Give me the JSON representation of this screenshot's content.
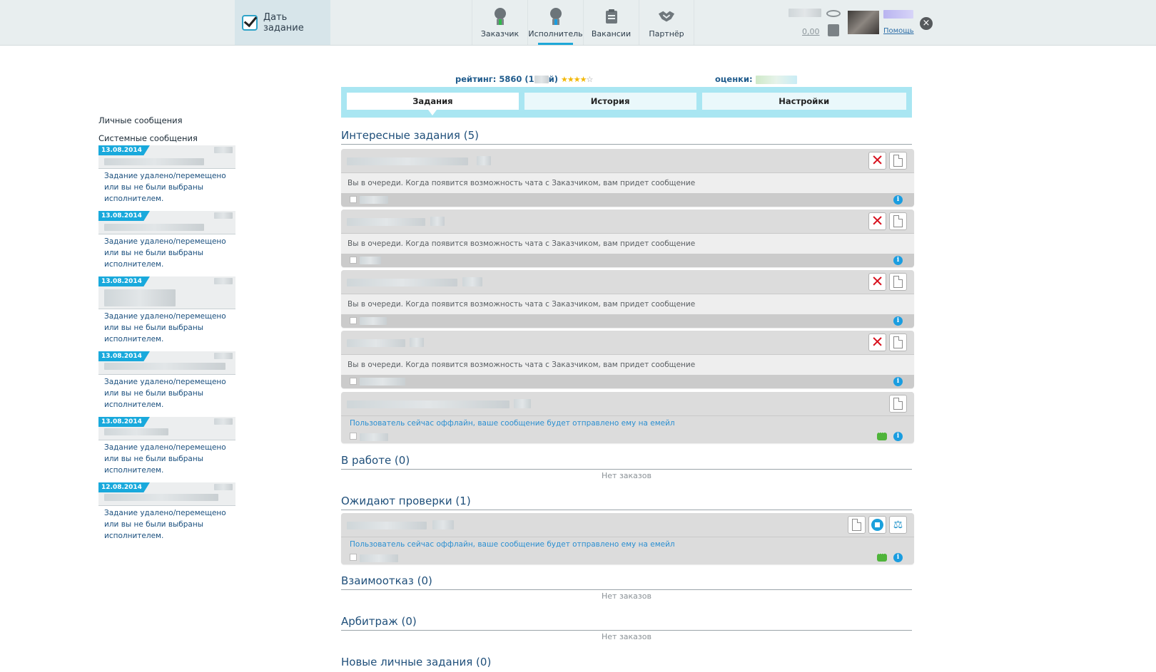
{
  "header": {
    "give_task_label": "Дать задание",
    "nav": [
      {
        "label": "Заказчик",
        "icon": "person-customer-icon"
      },
      {
        "label": "Исполнитель",
        "icon": "person-executor-icon"
      },
      {
        "label": "Вакансии",
        "icon": "clipboard-icon"
      },
      {
        "label": "Партнёр",
        "icon": "handshake-icon"
      }
    ],
    "balance": "0,00",
    "help_label": "Помощь",
    "close_icon": "close-icon"
  },
  "sidebar": {
    "personal_messages": "Личные сообщения",
    "system_messages": "Системные сообщения",
    "messages": [
      {
        "date": "13.08.2014",
        "text": "Задание удалено/перемещено или вы не были выбраны исполнителем."
      },
      {
        "date": "13.08.2014",
        "text": "Задание удалено/перемещено или вы не были выбраны исполнителем."
      },
      {
        "date": "13.08.2014",
        "text": "Задание удалено/перемещено или вы не были выбраны исполнителем."
      },
      {
        "date": "13.08.2014",
        "text": "Задание удалено/перемещено или вы не были выбраны исполнителем."
      },
      {
        "date": "13.08.2014",
        "text": "Задание удалено/перемещено или вы не были выбраны исполнителем."
      },
      {
        "date": "12.08.2014",
        "text": "Задание удалено/перемещено или вы не были выбраны исполнителем."
      }
    ]
  },
  "profile": {
    "rating_label": "рейтинг:",
    "rating_value": "5860",
    "rating_suffix": "(1",
    "rating_suffix_end": "й)",
    "stars_filled": 4,
    "stars_total": 5,
    "scores_label": "оценки:"
  },
  "tabs": [
    "Задания",
    "История",
    "Настройки"
  ],
  "sections": {
    "interesting": {
      "title": "Интересные задания (5)"
    },
    "in_work": {
      "title": "В работе (0)",
      "empty": "Нет заказов"
    },
    "review": {
      "title": "Ожидают проверки (1)"
    },
    "mutual_refusal": {
      "title": "Взаимоотказ (0)",
      "empty": "Нет заказов"
    },
    "arbitration": {
      "title": "Арбитраж (0)",
      "empty": "Нет заказов"
    },
    "new_personal": {
      "title": "Новые личные задания (0)"
    }
  },
  "tasks": {
    "queue_message": "Вы в очереди. Когда появится возможность чата с Заказчиком, вам придет сообщение",
    "offline_message": "Пользователь сейчас оффлайн, ваше сообщение будет отправлено ему на емейл",
    "info_glyph": "i"
  },
  "colors": {
    "accent": "#19a9dc",
    "tabs_bg": "#a9e6f2",
    "delete": "#d8121f",
    "chat": "#4fb43a"
  }
}
